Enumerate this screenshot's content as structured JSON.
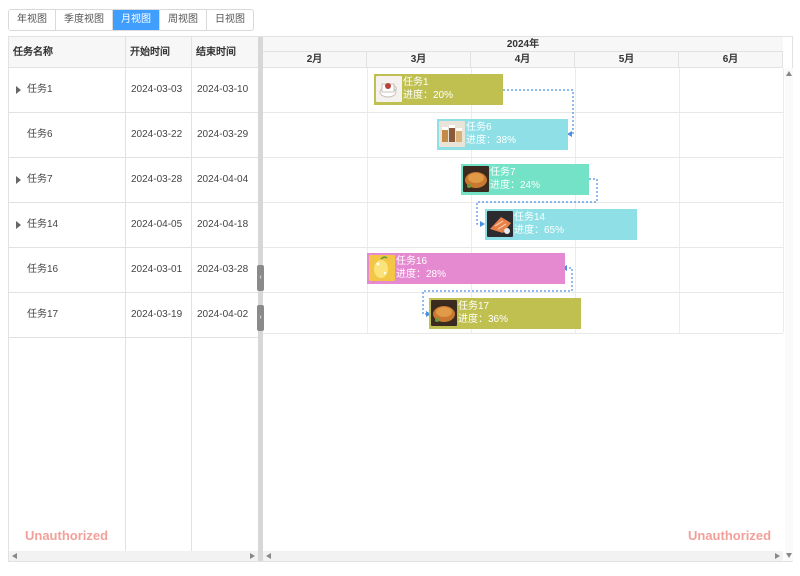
{
  "tabs": [
    {
      "label": "年视图",
      "active": false
    },
    {
      "label": "季度视图",
      "active": false
    },
    {
      "label": "月视图",
      "active": true
    },
    {
      "label": "周视图",
      "active": false
    },
    {
      "label": "日视图",
      "active": false
    }
  ],
  "table": {
    "columns": [
      "任务名称",
      "开始时间",
      "结束时间"
    ],
    "rows": [
      {
        "name": "任务1",
        "start": "2024-03-03",
        "end": "2024-03-10",
        "expandable": true
      },
      {
        "name": "任务6",
        "start": "2024-03-22",
        "end": "2024-03-29",
        "expandable": false
      },
      {
        "name": "任务7",
        "start": "2024-03-28",
        "end": "2024-04-04",
        "expandable": true
      },
      {
        "name": "任务14",
        "start": "2024-04-05",
        "end": "2024-04-18",
        "expandable": true
      },
      {
        "name": "任务16",
        "start": "2024-03-01",
        "end": "2024-03-28",
        "expandable": false
      },
      {
        "name": "任务17",
        "start": "2024-03-19",
        "end": "2024-04-02",
        "expandable": false
      }
    ]
  },
  "timeline": {
    "year": "2024年",
    "months": [
      "2月",
      "3月",
      "4月",
      "5月",
      "6月"
    ]
  },
  "bars": [
    {
      "name": "任务1",
      "progress": "进度：20%",
      "color": "#bfc050",
      "thumb": "cup-image"
    },
    {
      "name": "任务6",
      "progress": "进度：38%",
      "color": "#8ee0e6",
      "thumb": "jars-image"
    },
    {
      "name": "任务7",
      "progress": "进度：24%",
      "color": "#73e2c6",
      "thumb": "roast-image"
    },
    {
      "name": "任务14",
      "progress": "进度：65%",
      "color": "#8ee0e6",
      "thumb": "salmon-image"
    },
    {
      "name": "任务16",
      "progress": "进度：28%",
      "color": "#e589d1",
      "thumb": "lemon-image"
    },
    {
      "name": "任务17",
      "progress": "进度：36%",
      "color": "#bfc050",
      "thumb": "roast-image"
    }
  ],
  "colors": {
    "accent": "#409eff",
    "link": "#4a90e2",
    "watermark": "#f2a099"
  },
  "watermark": {
    "left": "Unauthorized",
    "right": "Unauthorized"
  },
  "splitter": {
    "collapse_left": "‹",
    "collapse_right": "›"
  }
}
